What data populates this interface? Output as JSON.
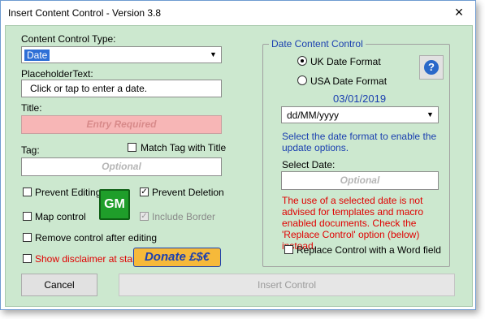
{
  "window": {
    "title": "Insert Content Control - Version 3.8",
    "close_glyph": "×"
  },
  "left": {
    "type_label": "Content Control Type:",
    "type_value": "Date",
    "placeholder_label": "PlaceholderText:",
    "placeholder_value": "Click or tap to enter a date.",
    "title_label": "Title:",
    "title_placeholder": "Entry Required",
    "tag_label": "Tag:",
    "match_tag_label": "Match Tag with Title",
    "tag_placeholder": "Optional",
    "prevent_editing_label": "Prevent Editing",
    "prevent_deletion_label": "Prevent Deletion",
    "map_control_label": "Map control",
    "include_border_label": "Include Border",
    "remove_control_label": "Remove control after editing",
    "show_disclaimer_label": "Show disclaimer at start",
    "gm_label": "GM",
    "donate_label": "Donate £$€"
  },
  "right": {
    "frame_title": "Date Content Control",
    "uk_format_label": "UK Date Format",
    "usa_format_label": "USA Date Format",
    "help_glyph": "?",
    "preview_date": "03/01/2019",
    "format_value": "dd/MM/yyyy",
    "select_format_hint": "Select the date format to enable the update options.",
    "select_date_label": "Select Date:",
    "select_date_placeholder": "Optional",
    "warning_text": "The use of a selected date is not advised for templates and macro enabled documents. Check the 'Replace Control' option (below) instead.",
    "replace_control_label": "Replace Control with a Word field"
  },
  "buttons": {
    "cancel": "Cancel",
    "insert": "Insert Control"
  },
  "state": {
    "prevent_editing": false,
    "prevent_deletion": true,
    "map_control": false,
    "include_border": true,
    "remove_control": false,
    "show_disclaimer": false,
    "match_tag": false,
    "replace_control": false,
    "date_format": "UK Date Format"
  },
  "colors": {
    "background": "#cce8cf",
    "accent_blue": "#1a3fb0",
    "warning_red": "#e00000",
    "required_pink": "#f7b6b6",
    "donate_orange": "#f6b93a",
    "gm_green": "#1f9e2a"
  },
  "icons": {
    "help": "question-mark-icon",
    "dropdown": "chevron-down-icon",
    "close": "close-icon"
  }
}
